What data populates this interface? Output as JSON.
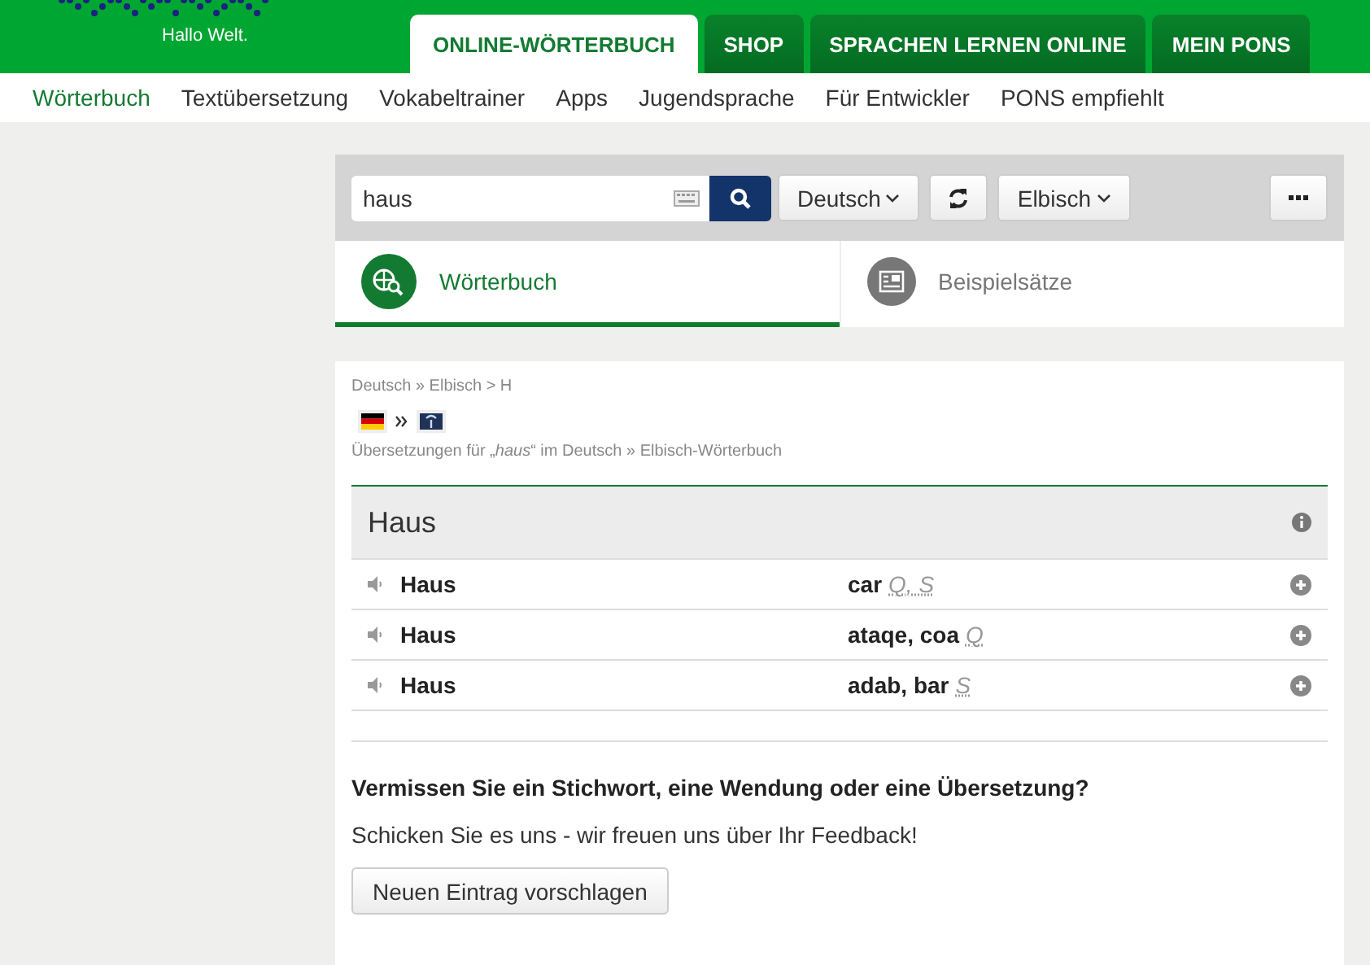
{
  "header": {
    "tagline": "Hallo Welt.",
    "tabs": [
      {
        "label": "ONLINE-WÖRTERBUCH",
        "selected": true
      },
      {
        "label": "SHOP",
        "selected": false
      },
      {
        "label": "SPRACHEN LERNEN ONLINE",
        "selected": false
      },
      {
        "label": "MEIN PONS",
        "selected": false
      }
    ]
  },
  "subnav": [
    {
      "label": "Wörterbuch",
      "selected": true
    },
    {
      "label": "Textübersetzung",
      "selected": false
    },
    {
      "label": "Vokabeltrainer",
      "selected": false
    },
    {
      "label": "Apps",
      "selected": false
    },
    {
      "label": "Jugendsprache",
      "selected": false
    },
    {
      "label": "Für Entwickler",
      "selected": false
    },
    {
      "label": "PONS empfiehlt",
      "selected": false
    }
  ],
  "search": {
    "value": "haus",
    "source_language": "Deutsch",
    "target_language": "Elbisch"
  },
  "mode_tabs": [
    {
      "label": "Wörterbuch",
      "selected": true
    },
    {
      "label": "Beispielsätze",
      "selected": false
    }
  ],
  "results": {
    "breadcrumb": "Deutsch » Elbisch > H",
    "title_line": "Übersetzungen für „*haus*“ im Deutsch » Elbisch-Wörterbuch",
    "headword": "Haus",
    "rows": [
      {
        "source": "Haus",
        "target": "car",
        "tags": "Q, S"
      },
      {
        "source": "Haus",
        "target": "ataqe, coa",
        "tags": "Q"
      },
      {
        "source": "Haus",
        "target": "adab, bar",
        "tags": "S"
      }
    ]
  },
  "feedback": {
    "heading": "Vermissen Sie ein Stichwort, eine Wendung oder eine Übersetzung?",
    "text": "Schicken Sie es uns - wir freuen uns über Ihr Feedback!",
    "button": "Neuen Eintrag vorschlagen"
  }
}
